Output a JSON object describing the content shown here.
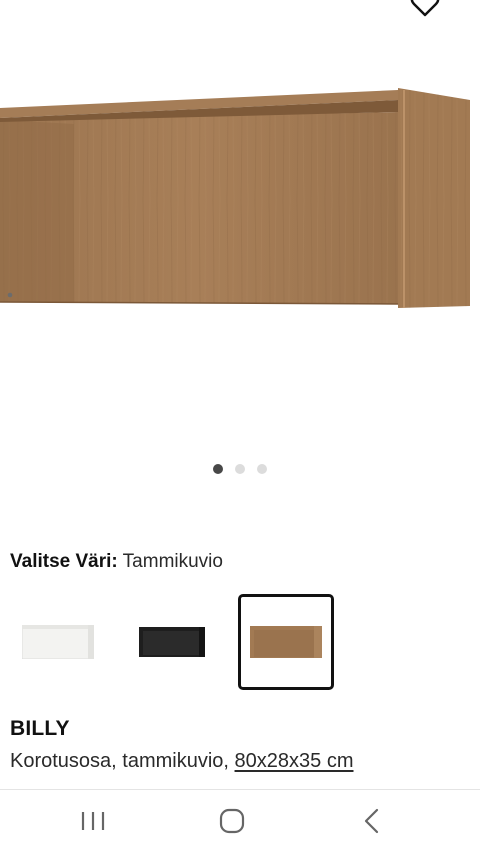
{
  "color_selector": {
    "label": "Valitse Väri:",
    "selected_value": "Tammikuvio",
    "swatches": [
      {
        "name": "white-swatch",
        "color": "#f2f2f0",
        "selected": false
      },
      {
        "name": "black-swatch",
        "color": "#1c1c1c",
        "selected": false
      },
      {
        "name": "oak-swatch",
        "color": "#a0794f",
        "selected": true
      }
    ]
  },
  "carousel": {
    "count": 3,
    "active_index": 0
  },
  "product": {
    "name": "BILLY",
    "description": "Korotusosa, tammikuvio, ",
    "dimensions": "80x28x35 cm"
  },
  "icons": {
    "favorite": "heart-icon",
    "recents": "recent-apps-icon",
    "home": "home-icon",
    "back": "back-icon"
  }
}
